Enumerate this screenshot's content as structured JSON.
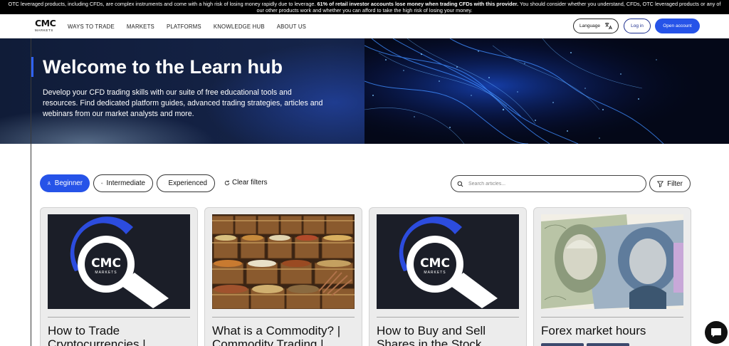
{
  "risk_banner": {
    "text_normal_1": "OTC leveraged products, including CFDs, are complex instruments and come with a high risk of losing money rapidly due to leverage. ",
    "text_bold": "61% of retail investor accounts lose money when trading CFDs with this provider.",
    "text_normal_2": " You should consider whether you understand, CFDs, OTC leveraged products or any of our other products work and whether you can afford to take the high risk of losing your money."
  },
  "nav": {
    "logo_mark": "CMC",
    "logo_sub": "MARKETS",
    "menu": [
      "WAYS TO TRADE",
      "MARKETS",
      "PLATFORMS",
      "KNOWLEDGE HUB",
      "ABOUT US"
    ],
    "language_label": "Language",
    "login_label": "Log in",
    "open_account_label": "Open account"
  },
  "hero": {
    "title": "Welcome to the Learn hub",
    "description": "Develop your CFD trading skills with our suite of free educational tools and resources. Find dedicated platform guides, advanced trading strategies, articles and webinars from our market analysts and more."
  },
  "filters": {
    "levels": [
      {
        "label": "Beginner",
        "active": true,
        "icon": "person-icon"
      },
      {
        "label": "Intermediate",
        "active": false,
        "icon": "graduation-cap-icon"
      },
      {
        "label": "Experienced",
        "active": false,
        "icon": "trophy-icon"
      }
    ],
    "clear_label": "Clear filters",
    "search_placeholder": "Search articles...",
    "filter_label": "Filter"
  },
  "cards": [
    {
      "title": "How to Trade Cryptocurrencies |",
      "image": "cmc-markets-logo-magnifier"
    },
    {
      "title": "What is a Commodity? | Commodity Trading |",
      "image": "spice-barrels-photo"
    },
    {
      "title": "How to Buy and Sell Shares in the Stock",
      "image": "cmc-markets-logo-magnifier"
    },
    {
      "title": "Forex market hours",
      "image": "banknotes-photo"
    }
  ],
  "colors": {
    "accent": "#2653e8",
    "hero_background": "#101c38",
    "card_background": "#ececec"
  }
}
